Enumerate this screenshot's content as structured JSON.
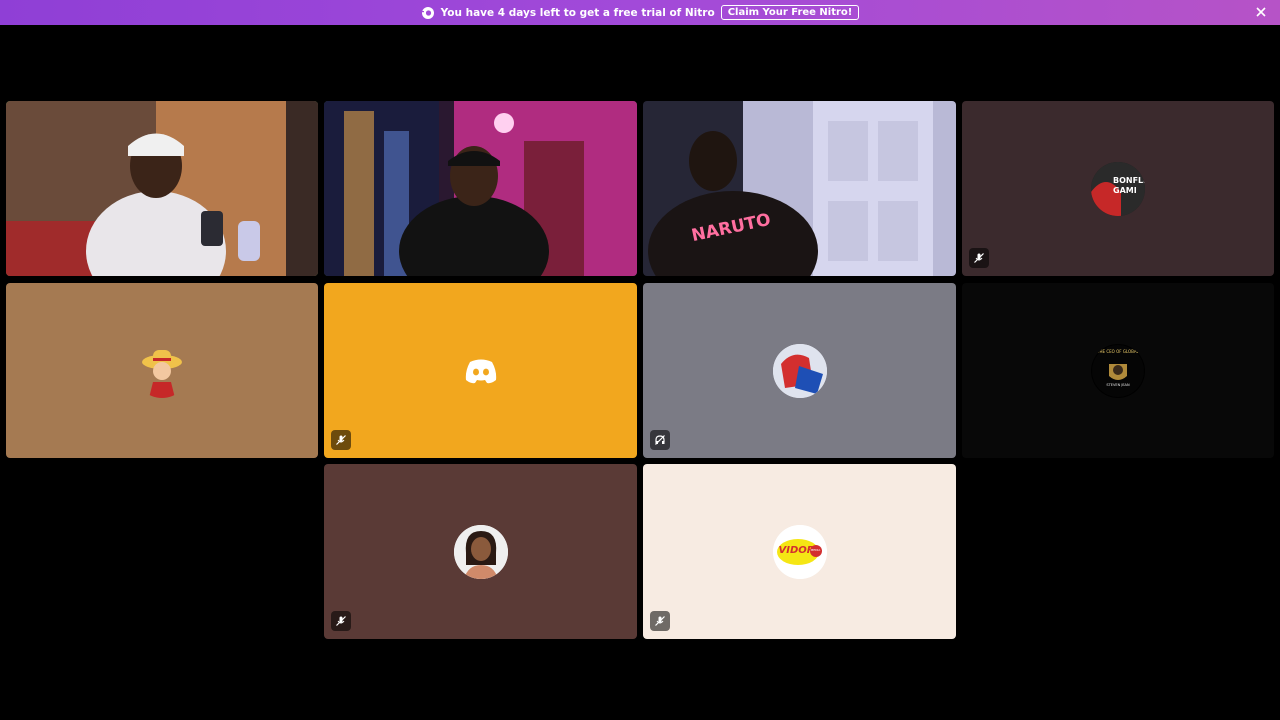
{
  "banner": {
    "message": "You have 4 days left to get a free trial of Nitro",
    "cta_label": "Claim Your Free Nitro!",
    "icon": "nitro-icon",
    "close_icon": "close-icon"
  },
  "participants": [
    {
      "id": "p1",
      "type": "video",
      "speaking": true
    },
    {
      "id": "p2",
      "type": "video",
      "speaking": true
    },
    {
      "id": "p3",
      "type": "video",
      "speaking": false,
      "shirt_text": "NARUTO"
    },
    {
      "id": "p4",
      "type": "avatar",
      "bg": "#3b2a2d",
      "muted": true,
      "avatar_text": "BONFLE GAMI"
    },
    {
      "id": "p5",
      "type": "avatar",
      "bg": "#a57a52",
      "muted": false
    },
    {
      "id": "p6",
      "type": "avatar",
      "bg": "#f2a71e",
      "muted": true,
      "avatar_icon": "discord-icon"
    },
    {
      "id": "p7",
      "type": "avatar",
      "bg": "#7b7b85",
      "muted": false,
      "deafened": true
    },
    {
      "id": "p8",
      "type": "avatar",
      "bg": "#080808",
      "muted": false,
      "avatar_text": "THE CEO OF GLOBAL",
      "avatar_subtext": "STEVEN JEAN"
    },
    {
      "id": "p9",
      "type": "avatar",
      "bg": "#5a3a36",
      "muted": true
    },
    {
      "id": "p10",
      "type": "avatar",
      "bg": "#f7ebe2",
      "muted": true,
      "avatar_text": "VIDOR",
      "avatar_badge": "MEDIA"
    }
  ],
  "colors": {
    "banner_start": "#8f3fd6",
    "banner_end": "#b653c7",
    "speaking_ring": "#3ba55c"
  }
}
